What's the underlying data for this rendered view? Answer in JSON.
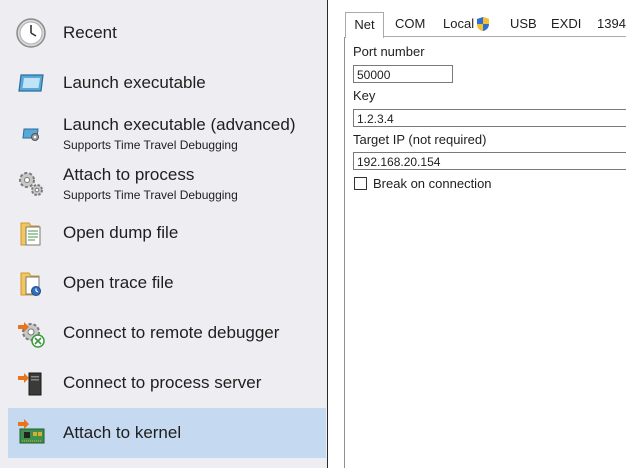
{
  "sidebar": {
    "items": [
      {
        "label": "Recent",
        "icon": "clock-icon"
      },
      {
        "label": "Launch executable",
        "icon": "window-icon"
      },
      {
        "label": "Launch executable (advanced)",
        "sub": "Supports Time Travel Debugging",
        "icon": "window-gear-icon"
      },
      {
        "label": "Attach to process",
        "sub": "Supports Time Travel Debugging",
        "icon": "gears-icon"
      },
      {
        "label": "Open dump file",
        "icon": "dump-file-icon"
      },
      {
        "label": "Open trace file",
        "icon": "trace-file-icon"
      },
      {
        "label": "Connect to remote debugger",
        "icon": "remote-debugger-icon"
      },
      {
        "label": "Connect to process server",
        "icon": "process-server-icon"
      },
      {
        "label": "Attach to kernel",
        "icon": "circuit-board-icon",
        "selected": true
      }
    ]
  },
  "tabs": [
    {
      "label": "Net",
      "active": true
    },
    {
      "label": "COM"
    },
    {
      "label": "Local",
      "icon": "uac-shield-icon"
    },
    {
      "label": "USB"
    },
    {
      "label": "EXDI"
    },
    {
      "label": "1394"
    }
  ],
  "form": {
    "port_label": "Port number",
    "port_value": "50000",
    "key_label": "Key",
    "key_value": "1.2.3.4",
    "target_label": "Target IP (not required)",
    "target_value": "192.168.20.154",
    "break_label": "Break on connection",
    "break_checked": false
  },
  "colors": {
    "sidebar_bg": "#eeeef2",
    "selected_bg": "#c5d9f1"
  }
}
